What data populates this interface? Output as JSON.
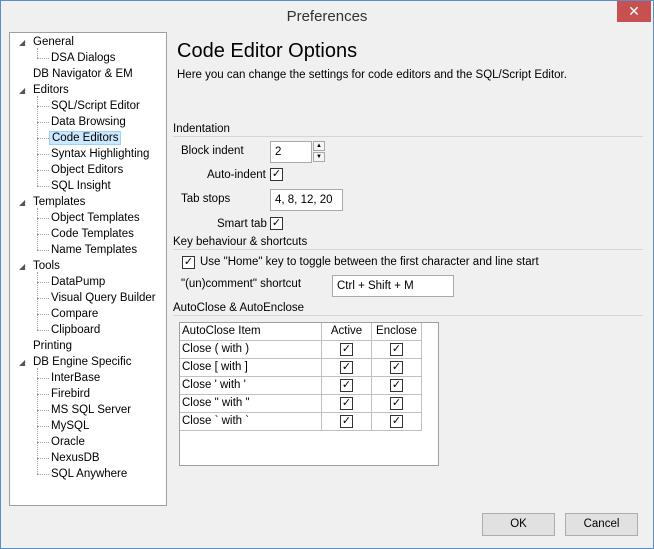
{
  "window": {
    "title": "Preferences",
    "close": "✕"
  },
  "tree": [
    {
      "label": "General",
      "level": 0,
      "expanded": true
    },
    {
      "label": "DSA Dialogs",
      "level": 1
    },
    {
      "label": "DB Navigator & EM",
      "level": 0
    },
    {
      "label": "Editors",
      "level": 0,
      "expanded": true
    },
    {
      "label": "SQL/Script Editor",
      "level": 1
    },
    {
      "label": "Data Browsing",
      "level": 1
    },
    {
      "label": "Code Editors",
      "level": 1,
      "selected": true
    },
    {
      "label": "Syntax Highlighting",
      "level": 1
    },
    {
      "label": "Object Editors",
      "level": 1
    },
    {
      "label": "SQL Insight",
      "level": 1
    },
    {
      "label": "Templates",
      "level": 0,
      "expanded": true
    },
    {
      "label": "Object Templates",
      "level": 1
    },
    {
      "label": "Code Templates",
      "level": 1
    },
    {
      "label": "Name Templates",
      "level": 1
    },
    {
      "label": "Tools",
      "level": 0,
      "expanded": true
    },
    {
      "label": "DataPump",
      "level": 1
    },
    {
      "label": "Visual Query Builder",
      "level": 1
    },
    {
      "label": "Compare",
      "level": 1
    },
    {
      "label": "Clipboard",
      "level": 1
    },
    {
      "label": "Printing",
      "level": 0
    },
    {
      "label": "DB Engine Specific",
      "level": 0,
      "expanded": true
    },
    {
      "label": "InterBase",
      "level": 1
    },
    {
      "label": "Firebird",
      "level": 1
    },
    {
      "label": "MS SQL Server",
      "level": 1
    },
    {
      "label": "MySQL",
      "level": 1
    },
    {
      "label": "Oracle",
      "level": 1
    },
    {
      "label": "NexusDB",
      "level": 1
    },
    {
      "label": "SQL Anywhere",
      "level": 1
    }
  ],
  "page": {
    "title": "Code Editor Options",
    "description": "Here you can change the settings for code editors and the SQL/Script Editor."
  },
  "indentation": {
    "section": "Indentation",
    "block_indent_label": "Block indent",
    "block_indent_value": "2",
    "auto_indent_label": "Auto-indent",
    "auto_indent_checked": true,
    "tab_stops_label": "Tab stops",
    "tab_stops_value": "4, 8, 12, 20",
    "smart_tab_label": "Smart tab",
    "smart_tab_checked": true
  },
  "keys": {
    "section": "Key behaviour & shortcuts",
    "home_label": "Use \"Home\" key to toggle between the first character and line start",
    "home_checked": true,
    "comment_label": "\"(un)comment\" shortcut",
    "comment_value": "Ctrl + Shift + M"
  },
  "autoclose": {
    "section": "AutoClose & AutoEnclose",
    "headers": [
      "AutoClose Item",
      "Active",
      "Enclose"
    ],
    "rows": [
      {
        "item": "Close ( with )",
        "active": true,
        "enclose": true
      },
      {
        "item": "Close [ with ]",
        "active": true,
        "enclose": true
      },
      {
        "item": "Close ' with '",
        "active": true,
        "enclose": true
      },
      {
        "item": "Close \" with \"",
        "active": true,
        "enclose": true
      },
      {
        "item": "Close ` with `",
        "active": true,
        "enclose": true
      }
    ]
  },
  "buttons": {
    "ok": "OK",
    "cancel": "Cancel"
  },
  "check_glyph": "✓"
}
